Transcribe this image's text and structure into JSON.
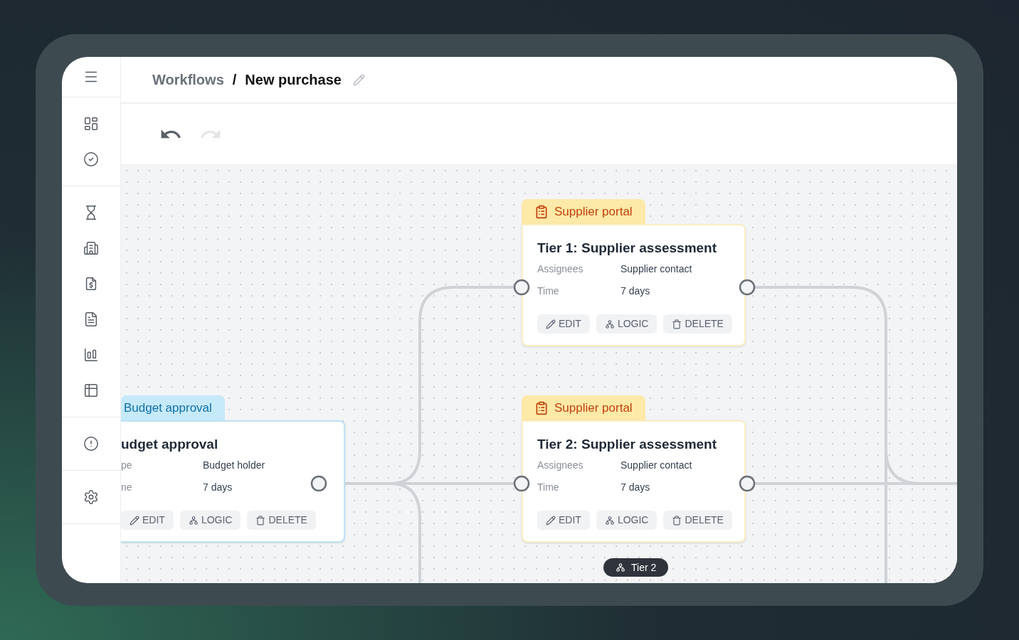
{
  "breadcrumb": {
    "parent": "Workflows",
    "separator": "/",
    "current": "New purchase"
  },
  "toolbar": {
    "undo": {
      "disabled": false
    },
    "redo": {
      "disabled": true
    }
  },
  "nodes": [
    {
      "kind": "supplier",
      "tab": "Supplier portal",
      "title": "Tier 1: Supplier assessment",
      "rows": [
        {
          "label": "Assignees",
          "value": "Supplier contact"
        },
        {
          "label": "Time",
          "value": "7 days"
        }
      ],
      "actions": [
        "EDIT",
        "LOGIC",
        "DELETE"
      ]
    },
    {
      "kind": "budget",
      "tab": "Budget approval",
      "title": "udget approval",
      "rows": [
        {
          "label": "pe",
          "value": "Budget holder"
        },
        {
          "label": "ne",
          "value": "7 days"
        }
      ],
      "actions": [
        "EDIT",
        "LOGIC",
        "DELETE"
      ]
    },
    {
      "kind": "supplier",
      "tab": "Supplier portal",
      "title": "Tier 2: Supplier assessment",
      "rows": [
        {
          "label": "Assignees",
          "value": "Supplier contact"
        },
        {
          "label": "Time",
          "value": "7 days"
        }
      ],
      "actions": [
        "EDIT",
        "LOGIC",
        "DELETE"
      ]
    }
  ],
  "branch_badge": "Tier 2"
}
